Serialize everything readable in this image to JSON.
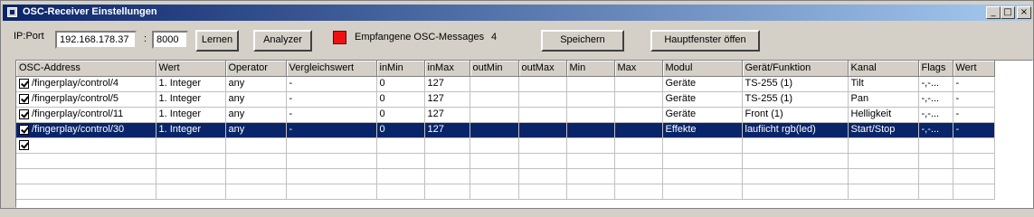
{
  "window": {
    "title": "OSC-Receiver Einstellungen",
    "minimize": "_",
    "maximize": "□",
    "close": "×"
  },
  "toolbar": {
    "ip_port_label": "IP:Port",
    "ip_value": "192.168.178.37",
    "colon": ":",
    "port_value": "8000",
    "learn_button": "Lernen",
    "analyzer_button": "Analyzer",
    "indicator_color": "#ee1111",
    "received_label": "Empfangene OSC-Messages",
    "received_count": "4",
    "save_button": "Speichern",
    "main_window_button": "Hauptfenster öffen"
  },
  "grid": {
    "columns": [
      "OSC-Address",
      "Wert",
      "Operator",
      "Vergleichswert",
      "inMin",
      "inMax",
      "outMin",
      "outMax",
      "Min",
      "Max",
      "Modul",
      "Gerät/Funktion",
      "Kanal",
      "Flags",
      "Wert"
    ],
    "rows": [
      {
        "checked": true,
        "selected": false,
        "cells": [
          "/fingerplay/control/4",
          "1. Integer",
          "any",
          "-",
          "0",
          "127",
          "",
          "",
          "",
          "",
          "Geräte",
          "TS-255 (1)",
          "Tilt",
          "-,-...",
          "-"
        ]
      },
      {
        "checked": true,
        "selected": false,
        "cells": [
          "/fingerplay/control/5",
          "1. Integer",
          "any",
          "-",
          "0",
          "127",
          "",
          "",
          "",
          "",
          "Geräte",
          "TS-255 (1)",
          "Pan",
          "-,-...",
          "-"
        ]
      },
      {
        "checked": true,
        "selected": false,
        "cells": [
          "/fingerplay/control/11",
          "1. Integer",
          "any",
          "-",
          "0",
          "127",
          "",
          "",
          "",
          "",
          "Geräte",
          "Front (1)",
          "Helligkeit",
          "-,-...",
          "-"
        ]
      },
      {
        "checked": true,
        "selected": true,
        "cells": [
          "/fingerplay/control/30",
          "1. Integer",
          "any",
          "-",
          "0",
          "127",
          "",
          "",
          "",
          "",
          "Effekte",
          "laufiicht rgb(led)",
          "Start/Stop",
          "-,-...",
          "-"
        ]
      },
      {
        "checked": true,
        "selected": false,
        "cells": [
          "",
          "",
          "",
          "",
          "",
          "",
          "",
          "",
          "",
          "",
          "",
          "",
          "",
          "",
          ""
        ]
      }
    ]
  }
}
